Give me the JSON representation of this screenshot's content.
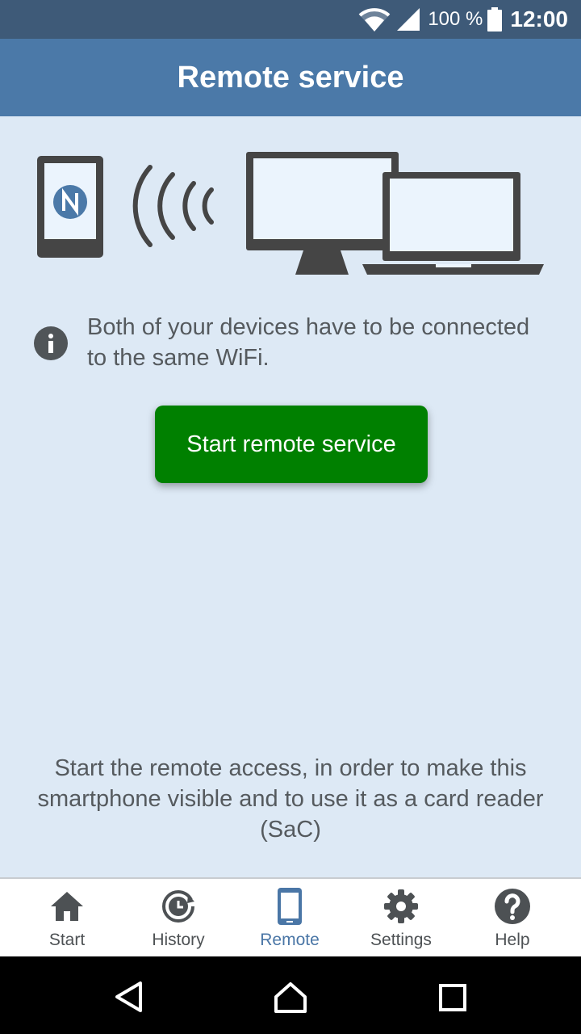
{
  "status_bar": {
    "battery_percent": "100 %",
    "time": "12:00",
    "icons": [
      "wifi-icon",
      "signal-icon",
      "battery-icon"
    ]
  },
  "app_bar": {
    "title": "Remote service"
  },
  "hero": {
    "icons": [
      "phone-nfc-icon",
      "wireless-waves-icon",
      "monitor-icon",
      "laptop-icon"
    ]
  },
  "info": {
    "icon": "info-icon",
    "text": "Both of your devices have to be connected to the same WiFi."
  },
  "start_button": {
    "label": "Start remote service"
  },
  "description": "Start the remote access, in order to make this smartphone visible and to use it as a card reader (SaC)",
  "bottom_nav": {
    "items": [
      {
        "label": "Start",
        "icon": "home-icon",
        "active": false
      },
      {
        "label": "History",
        "icon": "history-icon",
        "active": false
      },
      {
        "label": "Remote",
        "icon": "smartphone-icon",
        "active": true
      },
      {
        "label": "Settings",
        "icon": "gear-icon",
        "active": false
      },
      {
        "label": "Help",
        "icon": "help-icon",
        "active": false
      }
    ]
  },
  "system_nav": {
    "icons": [
      "back-icon",
      "home-nav-icon",
      "recents-icon"
    ]
  },
  "colors": {
    "status_bar": "#3e5a78",
    "app_bar": "#4b79a8",
    "background": "#dde9f5",
    "button": "#008000",
    "active_nav": "#4a76a6",
    "text": "#555a5e"
  }
}
